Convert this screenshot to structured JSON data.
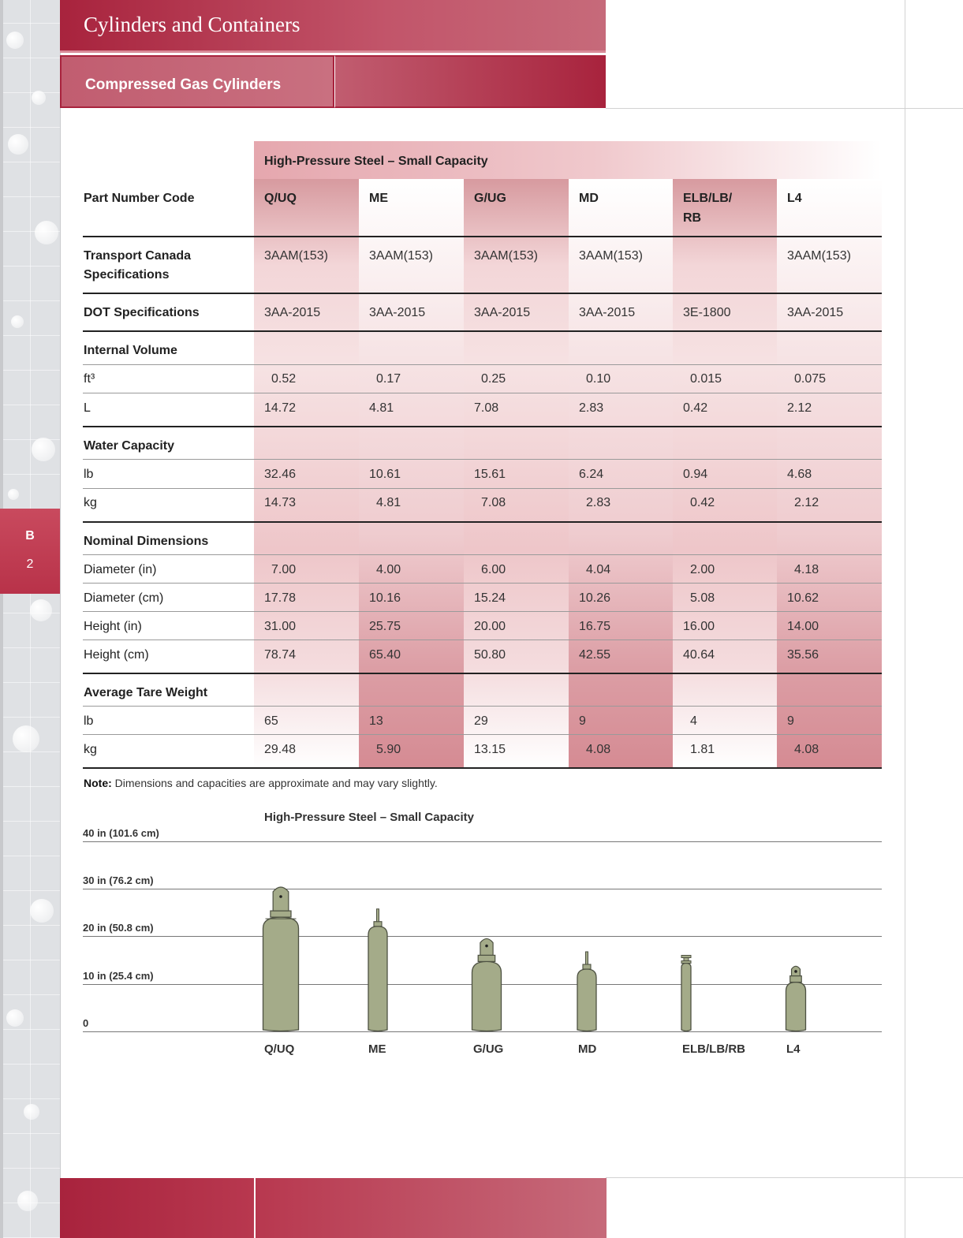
{
  "header": {
    "section_title": "Cylinders and Containers",
    "subsection_title": "Compressed Gas Cylinders"
  },
  "side_tab": {
    "letter": "B",
    "number": "2"
  },
  "table": {
    "title": "High-Pressure Steel – Small Capacity",
    "row_header_label": "Part Number Code",
    "columns": [
      "Q/UQ",
      "ME",
      "G/UG",
      "MD",
      "ELB/LB/",
      "L4"
    ],
    "column_line2": [
      "",
      "",
      "",
      "",
      "RB",
      ""
    ],
    "transport_canada": {
      "label_line1": "Transport Canada",
      "label_line2": "Specifications",
      "values": [
        "3AAM(153)",
        "3AAM(153)",
        "3AAM(153)",
        "3AAM(153)",
        "",
        "3AAM(153)"
      ]
    },
    "dot": {
      "label": "DOT Specifications",
      "values": [
        "3AA-2015",
        "3AA-2015",
        "3AA-2015",
        "3AA-2015",
        "3E-1800",
        "3AA-2015"
      ]
    },
    "internal_volume": {
      "label": "Internal Volume",
      "rows": [
        {
          "unit": "ft³",
          "values": [
            "0.52",
            "0.17",
            "0.25",
            "0.10",
            "0.015",
            "0.075"
          ]
        },
        {
          "unit": "L",
          "values": [
            "14.72",
            "4.81",
            "7.08",
            "2.83",
            "0.42",
            "2.12"
          ]
        }
      ]
    },
    "water_capacity": {
      "label": "Water Capacity",
      "rows": [
        {
          "unit": "lb",
          "values": [
            "32.46",
            "10.61",
            "15.61",
            "6.24",
            "0.94",
            "4.68"
          ]
        },
        {
          "unit": "kg",
          "values": [
            "14.73",
            "4.81",
            "7.08",
            "2.83",
            "0.42",
            "2.12"
          ]
        }
      ]
    },
    "nominal_dimensions": {
      "label": "Nominal Dimensions",
      "rows": [
        {
          "unit": "Diameter (in)",
          "values": [
            "7.00",
            "4.00",
            "6.00",
            "4.04",
            "2.00",
            "4.18"
          ]
        },
        {
          "unit": "Diameter (cm)",
          "values": [
            "17.78",
            "10.16",
            "15.24",
            "10.26",
            "5.08",
            "10.62"
          ]
        },
        {
          "unit": "Height (in)",
          "values": [
            "31.00",
            "25.75",
            "20.00",
            "16.75",
            "16.00",
            "14.00"
          ]
        },
        {
          "unit": "Height (cm)",
          "values": [
            "78.74",
            "65.40",
            "50.80",
            "42.55",
            "40.64",
            "35.56"
          ]
        }
      ]
    },
    "tare_weight": {
      "label": "Average Tare Weight",
      "rows": [
        {
          "unit": "lb",
          "values": [
            "65",
            "13",
            "29",
            "9",
            "4",
            "9"
          ]
        },
        {
          "unit": "kg",
          "values": [
            "29.48",
            "5.90",
            "13.15",
            "4.08",
            "1.81",
            "4.08"
          ]
        }
      ]
    }
  },
  "note": {
    "bold": "Note:",
    "text": " Dimensions and capacities are approximate and may vary slightly."
  },
  "chart_data": {
    "type": "bar",
    "title": "High-Pressure Steel – Small Capacity",
    "categories": [
      "Q/UQ",
      "ME",
      "G/UG",
      "MD",
      "ELB/LB/RB",
      "L4"
    ],
    "values": [
      31.0,
      25.75,
      20.0,
      16.75,
      16.0,
      14.0
    ],
    "ylim": [
      0,
      40
    ],
    "y_ticks": [
      "0",
      "10 in (25.4 cm)",
      "20 in (50.8 cm)",
      "30 in (76.2 cm)",
      "40 in (101.6 cm)"
    ],
    "y_tick_values": [
      0,
      10,
      20,
      30,
      40
    ],
    "valve_styles": [
      "cap",
      "stem",
      "cap",
      "stem",
      "handle",
      "cap"
    ],
    "grid": true,
    "bar_color": "#a4ab89"
  }
}
